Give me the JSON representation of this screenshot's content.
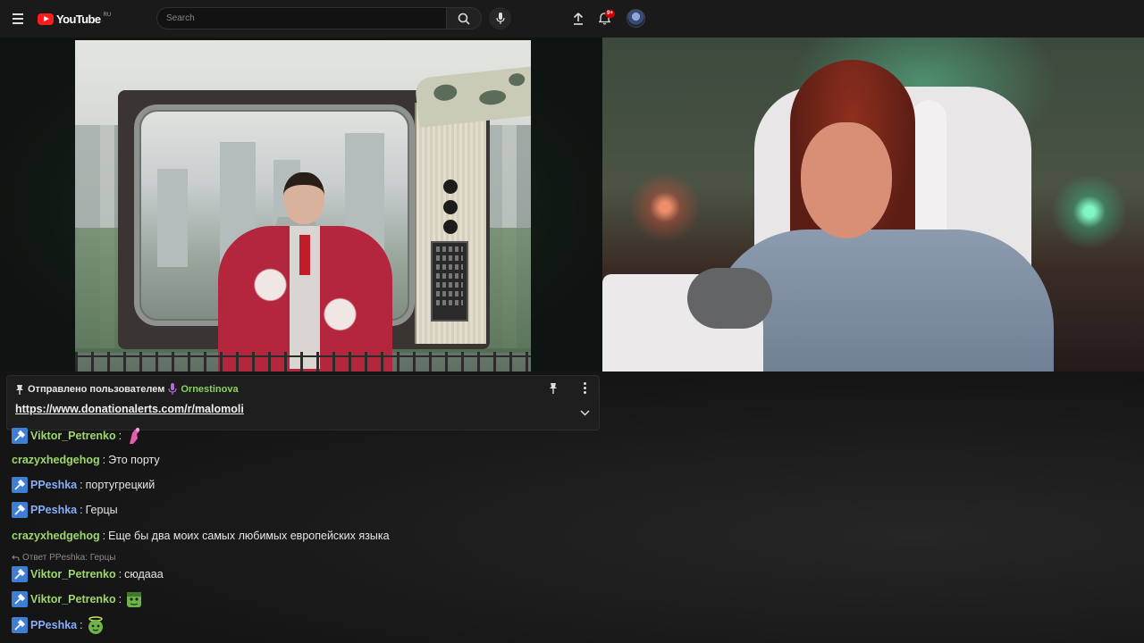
{
  "header": {
    "logo_text": "YouTube",
    "logo_region": "RU",
    "search_placeholder": "Search",
    "notification_count": "9+"
  },
  "pinned": {
    "label": "Отправлено пользователем",
    "user": "Ornestinova",
    "link": "https://www.donationalerts.com/r/malomoli"
  },
  "chat": {
    "messages": [
      {
        "user": "Viktor_Petrenko",
        "text": "",
        "emote": "pink-hand-emote"
      },
      {
        "user": "crazyxhedgehog",
        "text": "Это порту"
      },
      {
        "user": "PPeshka",
        "text": "португрецкий"
      },
      {
        "user": "PPeshka",
        "text": "Герцы"
      },
      {
        "user": "crazyxhedgehog",
        "text": "Еще бы два моих самых любимых европейских языка"
      },
      {
        "user": "Viktor_Petrenko",
        "text": "сюдааа"
      },
      {
        "user": "Viktor_Petrenko",
        "text": "",
        "emote": "green-frog-emote"
      },
      {
        "user": "PPeshka",
        "text": "",
        "emote": "green-halo-emote"
      }
    ],
    "reply_text": "Ответ PPeshka: Герцы",
    "separator": ":"
  },
  "colors": {
    "accent": "#ff1b1b",
    "username_green": "#9fd86a",
    "username_blue": "#87aef5",
    "badge_blue": "#3e7fd3"
  },
  "icons": [
    "menu-icon",
    "youtube-logo",
    "search-icon",
    "mic-icon",
    "upload-icon",
    "bell-icon",
    "pin-icon",
    "more-icon",
    "chevron-down-icon",
    "mod-badge-icon",
    "reply-icon"
  ]
}
